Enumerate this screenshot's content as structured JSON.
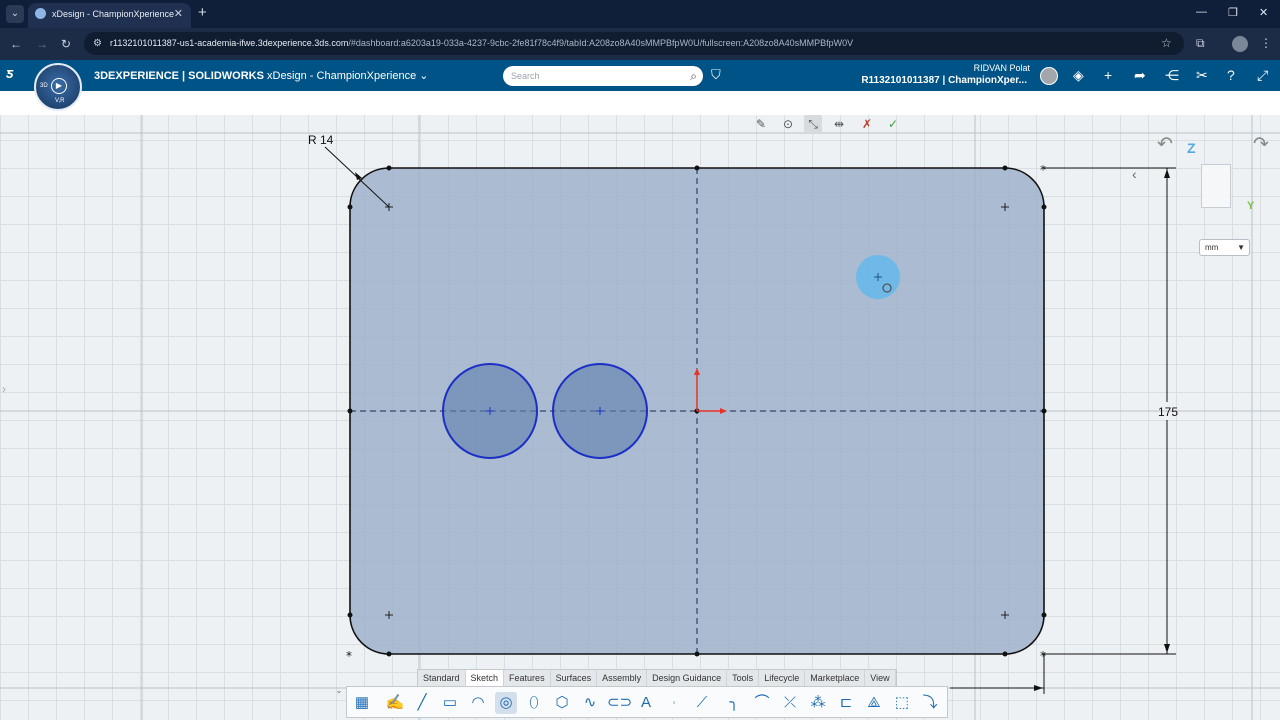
{
  "browser": {
    "tab_title": "xDesign - ChampionXperience",
    "url_host": "r1132101011387-us1-academia-ifwe.3dexperience.3ds.com",
    "url_rest": "/#dashboard:a6203a19-033a-4237-9cbc-2fe81f78c4f9/tabId:A208zo8A40sMMPBfpW0U/fullscreen:A208zo8A40sMMPBfpW0V"
  },
  "appbar": {
    "brand_bold": "3DEXPERIENCE | SOLIDWORKS",
    "brand_app": "xDesign - ChampionXperience",
    "search_placeholder": "Search",
    "user_name": "RIDVAN Polat",
    "user_context": "R1132101011387 | ChampionXper...",
    "compass_3d": "3D",
    "compass_vr": "V,R"
  },
  "canvas": {
    "radius_dim": "R 14",
    "height_dim": "175",
    "axis_z": "Z",
    "axis_y": "Y",
    "unit": "mm"
  },
  "command_tabs": [
    "Standard",
    "Sketch",
    "Features",
    "Surfaces",
    "Assembly",
    "Design Guidance",
    "Tools",
    "Lifecycle",
    "Marketplace",
    "View"
  ],
  "active_tab": "Sketch",
  "colors": {
    "appbar": "#005386",
    "sketch_fill": "#9fb4cc",
    "circle_stroke": "#1b2fc4",
    "axis_red": "#e8312a"
  }
}
